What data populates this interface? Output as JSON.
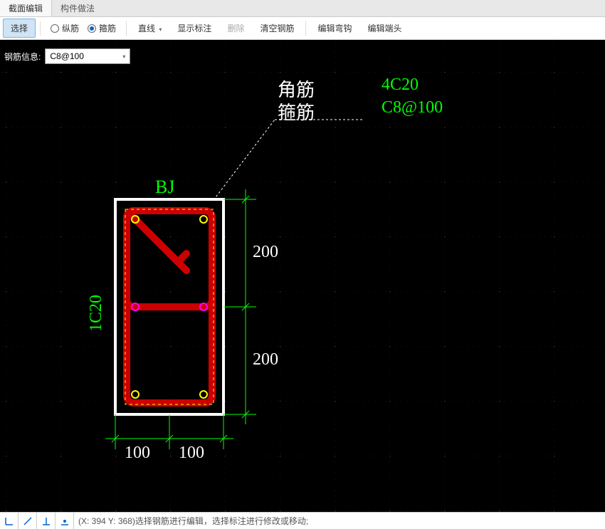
{
  "tabs": {
    "section_edit": "截面编辑",
    "component_method": "构件做法"
  },
  "toolbar": {
    "select": "选择",
    "longitudinal": "纵筋",
    "stirrup": "箍筋",
    "straight": "直线",
    "show_annotation": "显示标注",
    "delete": "删除",
    "clear_rebar": "清空钢筋",
    "edit_hook": "编辑弯钩",
    "edit_end": "编辑端头"
  },
  "rebar_info": {
    "label": "钢筋信息:",
    "value": "C8@100"
  },
  "annotations": {
    "corner_bar": "角筋",
    "stirrup": "箍筋",
    "corner_bar_val": "4C20",
    "stirrup_val": "C8@100",
    "label_bj": "BJ",
    "label_1c20": "1C20",
    "dim_200_1": "200",
    "dim_200_2": "200",
    "dim_100_1": "100",
    "dim_100_2": "100"
  },
  "status": {
    "text": "(X: 394 Y: 368)选择钢筋进行编辑，选择标注进行修改或移动;"
  }
}
